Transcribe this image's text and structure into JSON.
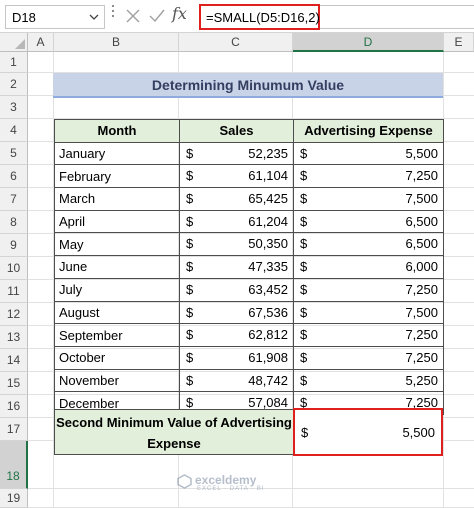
{
  "formula_bar": {
    "name_box": "D18",
    "formula": "=SMALL(D5:D16,2)"
  },
  "columns": [
    "A",
    "B",
    "C",
    "D",
    "E"
  ],
  "rows": [
    "1",
    "2",
    "3",
    "4",
    "5",
    "6",
    "7",
    "8",
    "9",
    "10",
    "11",
    "12",
    "13",
    "14",
    "15",
    "16",
    "17",
    "18",
    "19"
  ],
  "title": "Determining Minumum Value",
  "table": {
    "headers": [
      "Month",
      "Sales",
      "Advertising Expense"
    ],
    "rows": [
      {
        "month": "January",
        "sales": "52,235",
        "adv": "5,500"
      },
      {
        "month": "February",
        "sales": "61,104",
        "adv": "7,250"
      },
      {
        "month": "March",
        "sales": "65,425",
        "adv": "7,500"
      },
      {
        "month": "April",
        "sales": "61,204",
        "adv": "6,500"
      },
      {
        "month": "May",
        "sales": "50,350",
        "adv": "6,500"
      },
      {
        "month": "June",
        "sales": "47,335",
        "adv": "6,000"
      },
      {
        "month": "July",
        "sales": "63,452",
        "adv": "7,250"
      },
      {
        "month": "August",
        "sales": "67,536",
        "adv": "7,500"
      },
      {
        "month": "September",
        "sales": "62,812",
        "adv": "7,250"
      },
      {
        "month": "October",
        "sales": "61,908",
        "adv": "7,250"
      },
      {
        "month": "November",
        "sales": "48,742",
        "adv": "5,250"
      },
      {
        "month": "December",
        "sales": "57,084",
        "adv": "7,250"
      }
    ],
    "currency": "$"
  },
  "summary": {
    "label": "Second Minimum Value of Advertising Expense",
    "currency": "$",
    "value": "5,500"
  },
  "watermark": {
    "name": "exceldemy",
    "tagline": "EXCEL · DATA · BI"
  },
  "colors": {
    "selection_border": "#e0201e",
    "header_fill": "#e2efda",
    "title_fill": "#c9d3e8",
    "excel_green": "#217346"
  }
}
